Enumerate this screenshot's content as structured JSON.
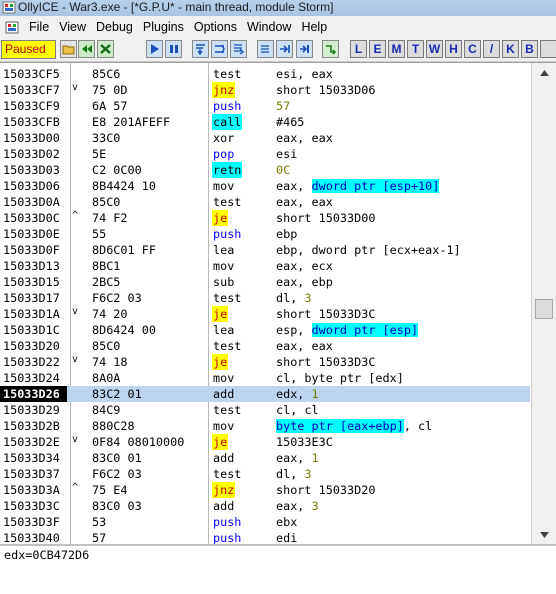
{
  "window": {
    "title": "OllyICE - War3.exe - [*G.P.U* - main thread, module Storm]"
  },
  "menu": [
    "File",
    "View",
    "Debug",
    "Plugins",
    "Options",
    "Window",
    "Help"
  ],
  "toolbar": {
    "status": "Paused",
    "status_color": "#ffff00",
    "buttons": [
      "open-icon",
      "restart-icon",
      "close-icon",
      "run-icon",
      "pause-icon",
      "step-into-icon",
      "step-over-icon",
      "trace-into-icon",
      "trace-over-icon",
      "execute-till-return-icon",
      "goto-icon"
    ],
    "letters": [
      "L",
      "E",
      "M",
      "T",
      "W",
      "H",
      "C",
      "/",
      "K",
      "B"
    ]
  },
  "disassembly": {
    "rows": [
      {
        "addr": "15033CF5",
        "jm": "",
        "hex": "85C6",
        "mnem": "test",
        "ops": [
          {
            "t": "esi, eax"
          }
        ]
      },
      {
        "addr": "15033CF7",
        "jm": "v",
        "hex": "75 0D",
        "mnem": "jnz",
        "kind": "jcc",
        "ops": [
          {
            "t": "short 15033D06"
          }
        ]
      },
      {
        "addr": "15033CF9",
        "jm": "",
        "hex": "6A 57",
        "mnem": "push",
        "kind": "push",
        "ops": [
          {
            "t": "57",
            "c": "n"
          }
        ]
      },
      {
        "addr": "15033CFB",
        "jm": "",
        "hex": "E8 201AFEFF",
        "mnem": "call",
        "kind": "call",
        "ops": [
          {
            "t": "#465"
          }
        ]
      },
      {
        "addr": "15033D00",
        "jm": "",
        "hex": "33C0",
        "mnem": "xor",
        "ops": [
          {
            "t": "eax, eax"
          }
        ]
      },
      {
        "addr": "15033D02",
        "jm": "",
        "hex": "5E",
        "mnem": "pop",
        "kind": "push",
        "ops": [
          {
            "t": "esi"
          }
        ]
      },
      {
        "addr": "15033D03",
        "jm": "",
        "hex": "C2 0C00",
        "mnem": "retn",
        "kind": "retn",
        "ops": [
          {
            "t": "0C",
            "c": "n"
          }
        ]
      },
      {
        "addr": "15033D06",
        "jm": "",
        "hex": "8B4424 10",
        "mnem": "mov",
        "ops": [
          {
            "t": "eax, "
          },
          {
            "t": "dword ptr [esp+10]",
            "c": "hl"
          }
        ]
      },
      {
        "addr": "15033D0A",
        "jm": "",
        "hex": "85C0",
        "mnem": "test",
        "ops": [
          {
            "t": "eax, eax"
          }
        ]
      },
      {
        "addr": "15033D0C",
        "jm": "^",
        "hex": "74 F2",
        "mnem": "je",
        "kind": "jcc",
        "ops": [
          {
            "t": "short 15033D00"
          }
        ]
      },
      {
        "addr": "15033D0E",
        "jm": "",
        "hex": "55",
        "mnem": "push",
        "kind": "push",
        "ops": [
          {
            "t": "ebp"
          }
        ]
      },
      {
        "addr": "15033D0F",
        "jm": "",
        "hex": "8D6C01 FF",
        "mnem": "lea",
        "ops": [
          {
            "t": "ebp, dword ptr [ecx+eax-1]"
          }
        ]
      },
      {
        "addr": "15033D13",
        "jm": "",
        "hex": "8BC1",
        "mnem": "mov",
        "ops": [
          {
            "t": "eax, ecx"
          }
        ]
      },
      {
        "addr": "15033D15",
        "jm": "",
        "hex": "2BC5",
        "mnem": "sub",
        "ops": [
          {
            "t": "eax, ebp"
          }
        ]
      },
      {
        "addr": "15033D17",
        "jm": "",
        "hex": "F6C2 03",
        "mnem": "test",
        "ops": [
          {
            "t": "dl, "
          },
          {
            "t": "3",
            "c": "n"
          }
        ]
      },
      {
        "addr": "15033D1A",
        "jm": "v",
        "hex": "74 20",
        "mnem": "je",
        "kind": "jcc",
        "ops": [
          {
            "t": "short 15033D3C"
          }
        ]
      },
      {
        "addr": "15033D1C",
        "jm": "",
        "hex": "8D6424 00",
        "mnem": "lea",
        "ops": [
          {
            "t": "esp, "
          },
          {
            "t": "dword ptr [esp]",
            "c": "hl"
          }
        ]
      },
      {
        "addr": "15033D20",
        "jm": "",
        "hex": "85C0",
        "mnem": "test",
        "ops": [
          {
            "t": "eax, eax"
          }
        ]
      },
      {
        "addr": "15033D22",
        "jm": "v",
        "hex": "74 18",
        "mnem": "je",
        "kind": "jcc",
        "ops": [
          {
            "t": "short 15033D3C"
          }
        ]
      },
      {
        "addr": "15033D24",
        "jm": "",
        "hex": "8A0A",
        "mnem": "mov",
        "ops": [
          {
            "t": "cl, byte ptr [edx]"
          }
        ]
      },
      {
        "addr": "15033D26",
        "jm": "",
        "hex": "83C2 01",
        "mnem": "add",
        "sel": true,
        "ops": [
          {
            "t": "edx, "
          },
          {
            "t": "1",
            "c": "n"
          }
        ]
      },
      {
        "addr": "15033D29",
        "jm": "",
        "hex": "84C9",
        "mnem": "test",
        "ops": [
          {
            "t": "cl, cl"
          }
        ]
      },
      {
        "addr": "15033D2B",
        "jm": "",
        "hex": "880C28",
        "mnem": "mov",
        "ops": [
          {
            "t": "byte ptr [eax+ebp]",
            "c": "hl"
          },
          {
            "t": ", cl"
          }
        ]
      },
      {
        "addr": "15033D2E",
        "jm": "v",
        "hex": "0F84 08010000",
        "mnem": "je",
        "kind": "jcc",
        "ops": [
          {
            "t": "15033E3C"
          }
        ]
      },
      {
        "addr": "15033D34",
        "jm": "",
        "hex": "83C0 01",
        "mnem": "add",
        "ops": [
          {
            "t": "eax, "
          },
          {
            "t": "1",
            "c": "n"
          }
        ]
      },
      {
        "addr": "15033D37",
        "jm": "",
        "hex": "F6C2 03",
        "mnem": "test",
        "ops": [
          {
            "t": "dl, "
          },
          {
            "t": "3",
            "c": "n"
          }
        ]
      },
      {
        "addr": "15033D3A",
        "jm": "^",
        "hex": "75 E4",
        "mnem": "jnz",
        "kind": "jcc",
        "ops": [
          {
            "t": "short 15033D20"
          }
        ]
      },
      {
        "addr": "15033D3C",
        "jm": "",
        "hex": "83C0 03",
        "mnem": "add",
        "ops": [
          {
            "t": "eax, "
          },
          {
            "t": "3",
            "c": "n"
          }
        ]
      },
      {
        "addr": "15033D3F",
        "jm": "",
        "hex": "53",
        "mnem": "push",
        "kind": "push",
        "ops": [
          {
            "t": "ebx"
          }
        ]
      },
      {
        "addr": "15033D40",
        "jm": "",
        "hex": "57",
        "mnem": "push",
        "kind": "push",
        "ops": [
          {
            "t": "edi"
          }
        ]
      }
    ]
  },
  "info_pane": {
    "text": "edx=0CB472D6"
  }
}
